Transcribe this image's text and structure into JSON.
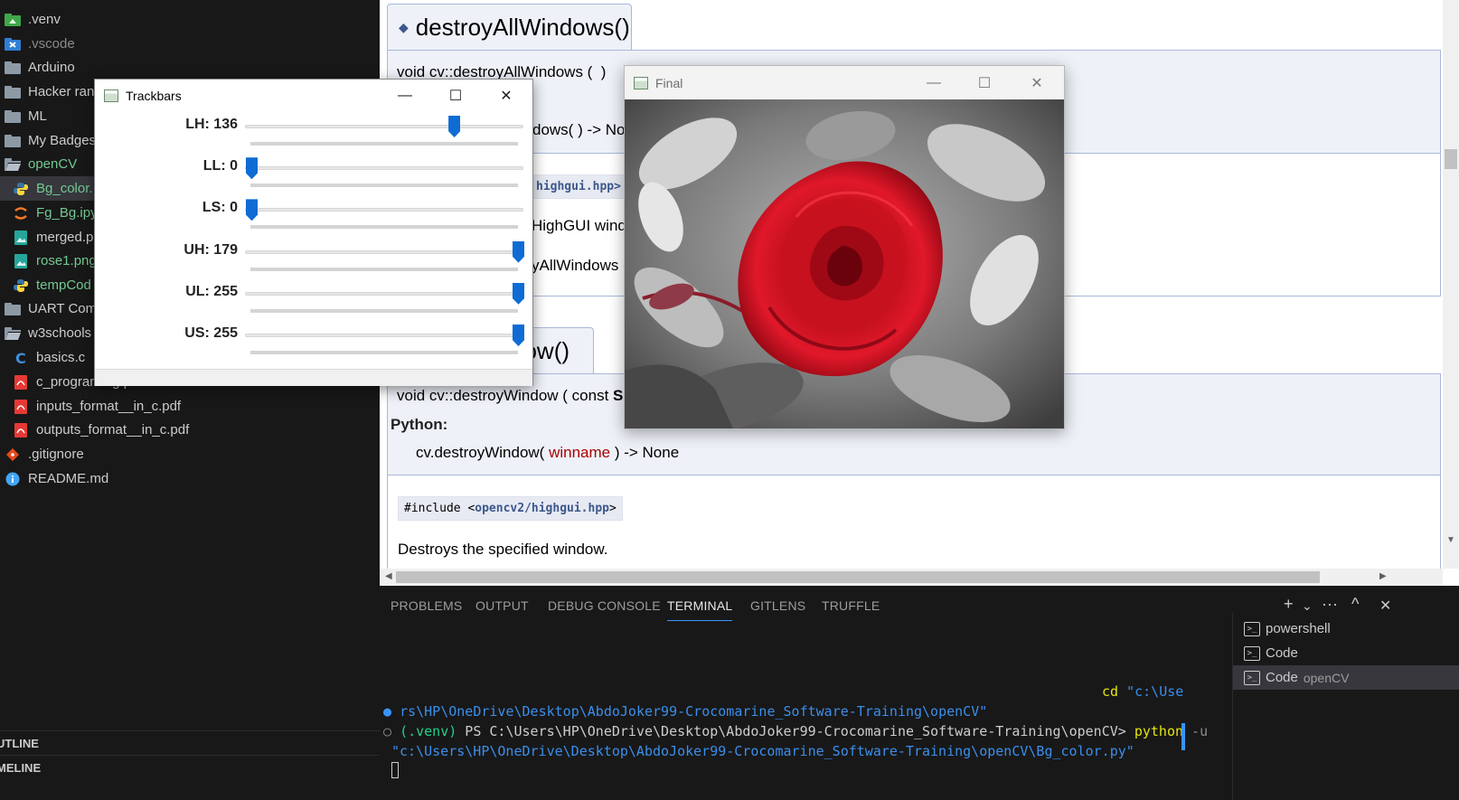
{
  "explorer": {
    "items": [
      {
        "label": ".venv",
        "icon": "venv-folder-icon",
        "style": "normal"
      },
      {
        "label": ".vscode",
        "icon": "vscode-folder-icon",
        "style": "dim"
      },
      {
        "label": "Arduino",
        "icon": "folder-icon",
        "style": "normal"
      },
      {
        "label": "Hacker ran",
        "icon": "folder-icon",
        "style": "normal"
      },
      {
        "label": "ML",
        "icon": "folder-icon",
        "style": "normal"
      },
      {
        "label": "My Badges",
        "icon": "folder-icon",
        "style": "normal"
      },
      {
        "label": "openCV",
        "icon": "folder-open-icon",
        "style": "green"
      },
      {
        "label": "Bg_color.",
        "icon": "python-file-icon",
        "style": "green"
      },
      {
        "label": "Fg_Bg.ipy",
        "icon": "jupyter-file-icon",
        "style": "green"
      },
      {
        "label": "merged.p",
        "icon": "image-file-icon",
        "style": "normal"
      },
      {
        "label": "rose1.png",
        "icon": "image-file-icon",
        "style": "green"
      },
      {
        "label": "tempCod",
        "icon": "python-file-icon",
        "style": "green"
      },
      {
        "label": "UART Com",
        "icon": "folder-icon",
        "style": "normal"
      },
      {
        "label": "w3schools",
        "icon": "folder-open-icon",
        "style": "normal"
      },
      {
        "label": "basics.c",
        "icon": "c-file-icon",
        "style": "normal"
      },
      {
        "label": "c_program...g.pdf",
        "icon": "pdf-file-icon",
        "style": "normal"
      },
      {
        "label": "inputs_format__in_c.pdf",
        "icon": "pdf-file-icon",
        "style": "normal"
      },
      {
        "label": "outputs_format__in_c.pdf",
        "icon": "pdf-file-icon",
        "style": "normal"
      },
      {
        "label": ".gitignore",
        "icon": "git-icon",
        "style": "normal"
      },
      {
        "label": "README.md",
        "icon": "info-icon",
        "style": "normal"
      }
    ],
    "outline_label": "UTLINE",
    "timeline_label": "MELINE"
  },
  "doc": {
    "section1": {
      "title": "destroyAllWindows()",
      "cpp_sig_a": "void cv::destroyAllWindows (",
      "cpp_sig_b": ")",
      "python_sig_tail": "dows(  ) -> No",
      "include_fragment": "highgui.hpp>",
      "text1": "HighGUI windo",
      "text2": "yAllWindows c"
    },
    "section2": {
      "title_fragment": "dow()",
      "cpp_sig_a": "void cv::destroyWindow ( const ",
      "cpp_sig_b": "S",
      "python_label": "Python:",
      "python_sig_a": "cv.destroyWindow( ",
      "python_arg": "winname",
      "python_sig_b": " ) -> None",
      "include_prefix": "#include <",
      "include_link": "opencv2/highgui.hpp",
      "include_suffix": ">",
      "description": "Destroys the specified window."
    }
  },
  "panel": {
    "tabs": [
      "PROBLEMS",
      "OUTPUT",
      "DEBUG CONSOLE",
      "TERMINAL",
      "GITLENS",
      "TRUFFLE"
    ],
    "active_tab": "TERMINAL",
    "actions": {
      "new": "+",
      "dropdown": "⌄",
      "more": "···",
      "maximize": "^",
      "close": "✕"
    },
    "terminal": {
      "line1_cmd": "cd",
      "line1_arg": "\"c:\\Use",
      "line2": "rs\\HP\\OneDrive\\Desktop\\AbdoJoker99-Crocomarine_Software-Training\\openCV\"",
      "line3_env": "(.venv)",
      "line3_prompt": " PS C:\\Users\\HP\\OneDrive\\Desktop\\AbdoJoker99-Crocomarine_Software-Training\\openCV> ",
      "line3_cmd": "python",
      "line3_flag": " -u",
      "line4": "\"c:\\Users\\HP\\OneDrive\\Desktop\\AbdoJoker99-Crocomarine_Software-Training\\openCV\\Bg_color.py\""
    },
    "terminals": [
      {
        "label": "powershell",
        "desc": ""
      },
      {
        "label": "Code",
        "desc": ""
      },
      {
        "label": "Code",
        "desc": "openCV"
      }
    ]
  },
  "trackbars_window": {
    "title": "Trackbars",
    "controls": {
      "minimize": "—",
      "maximize": "☐",
      "close": "✕"
    },
    "sliders": [
      {
        "name": "LH",
        "label": "LH: 136",
        "value": 136,
        "max": 179
      },
      {
        "name": "LL",
        "label": "LL: 0",
        "value": 0,
        "max": 255
      },
      {
        "name": "LS",
        "label": "LS: 0",
        "value": 0,
        "max": 255
      },
      {
        "name": "UH",
        "label": "UH: 179",
        "value": 179,
        "max": 179
      },
      {
        "name": "UL",
        "label": "UL: 255",
        "value": 255,
        "max": 255
      },
      {
        "name": "US",
        "label": "US: 255",
        "value": 255,
        "max": 255
      }
    ]
  },
  "final_window": {
    "title": "Final",
    "controls": {
      "minimize": "—",
      "maximize": "☐",
      "close": "✕"
    },
    "image": "red-rose-on-grayscale-background"
  },
  "colors": {
    "accent": "#3794ff",
    "slider_thumb": "#0f6cd4",
    "rose_red": "#d0101c",
    "git_added_green": "#73c991"
  }
}
